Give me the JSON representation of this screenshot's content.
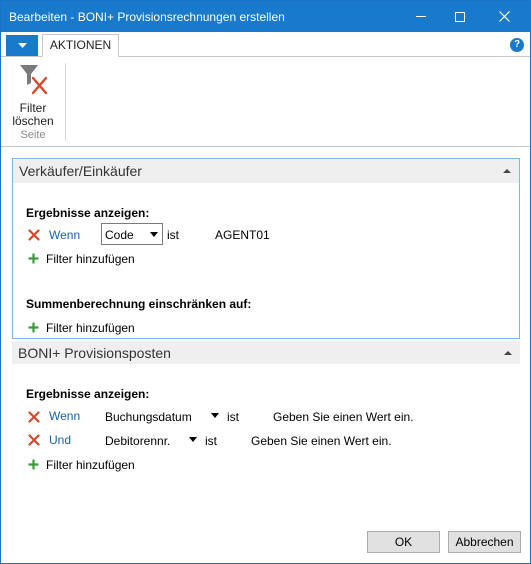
{
  "window": {
    "title": "Bearbeiten - BONI+ Provisionsrechnungen erstellen",
    "titlebar_color": "#1979ca"
  },
  "ribbon": {
    "tab_actions": "AKTIONEN",
    "clear_filter_line1": "Filter",
    "clear_filter_line2": "löschen",
    "group_label": "Seite"
  },
  "panel1": {
    "title": "Verkäufer/Einkäufer",
    "results_title": "Ergebnisse anzeigen:",
    "filter_row": {
      "conjunction": "Wenn",
      "field": "Code",
      "operator": "ist",
      "value": "AGENT01"
    },
    "add_filter_1": "Filter hinzufügen",
    "sum_title": "Summenberechnung einschränken auf:",
    "add_filter_2": "Filter hinzufügen"
  },
  "panel2": {
    "title": "BONI+ Provisionsposten",
    "results_title": "Ergebnisse anzeigen:",
    "rows": [
      {
        "conjunction": "Wenn",
        "field": "Buchungsdatum",
        "operator": "ist",
        "value": "Geben Sie einen Wert ein."
      },
      {
        "conjunction": "Und",
        "field": "Debitorennr.",
        "operator": "ist",
        "value": "Geben Sie einen Wert ein."
      }
    ],
    "add_filter": "Filter hinzufügen"
  },
  "buttons": {
    "ok": "OK",
    "cancel": "Abbrechen"
  },
  "icons": {
    "app_menu": "chevron-down-icon",
    "help": "help-icon",
    "clear_filter": "filter-clear-icon",
    "remove": "close-x-icon",
    "add": "plus-icon",
    "collapse": "chevron-up-icon"
  },
  "colors": {
    "accent": "#1979ca",
    "remove_x": "#d9472b",
    "add_plus": "#3c9a3c",
    "link": "#1a5fa8"
  }
}
